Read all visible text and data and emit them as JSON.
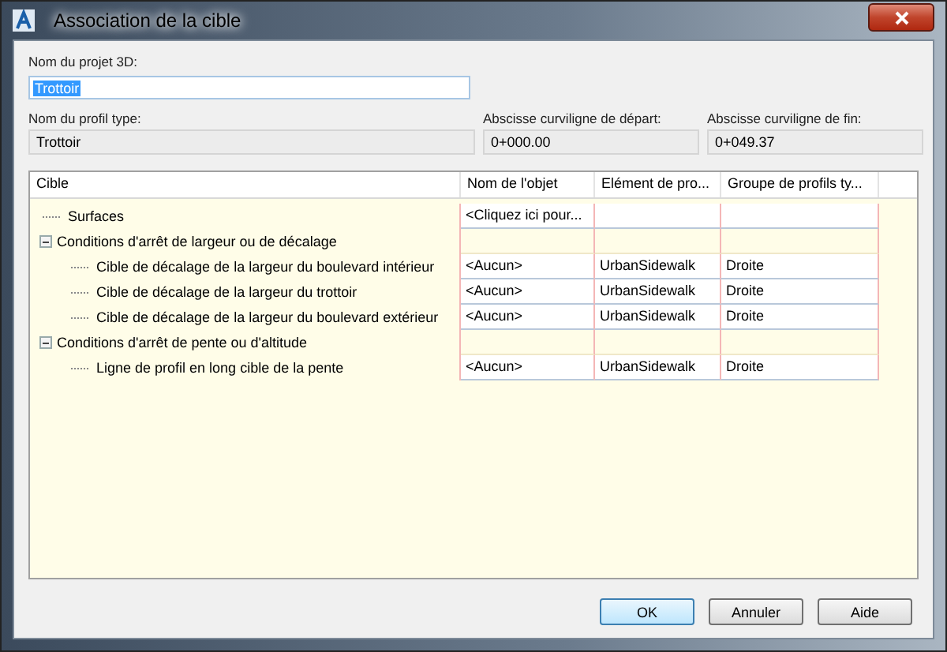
{
  "window": {
    "title": "Association de la cible"
  },
  "project_name": {
    "label": "Nom du projet 3D:",
    "value": "Trottoir"
  },
  "profile_type": {
    "label": "Nom du profil type:",
    "value": "Trottoir"
  },
  "start_station": {
    "label": "Abscisse curviligne de départ:",
    "value": "0+000.00"
  },
  "end_station": {
    "label": "Abscisse curviligne de fin:",
    "value": "0+049.37"
  },
  "table": {
    "columns": [
      "Cible",
      "Nom de l'objet",
      "Elément de pro...",
      "Groupe de profils ty..."
    ],
    "rows": [
      {
        "kind": "item",
        "label": "Surfaces",
        "cells": [
          "<Cliquez ici pour...",
          "",
          ""
        ]
      },
      {
        "kind": "group",
        "label": "Conditions d'arrêt de largeur ou de décalage",
        "expanded": true,
        "children": [
          {
            "kind": "item",
            "label": "Cible de décalage de la largeur du boulevard intérieur",
            "cells": [
              "<Aucun>",
              "UrbanSidewalk",
              "Droite"
            ]
          },
          {
            "kind": "item",
            "label": "Cible de décalage de la largeur du trottoir",
            "cells": [
              "<Aucun>",
              "UrbanSidewalk",
              "Droite"
            ]
          },
          {
            "kind": "item",
            "label": "Cible de décalage de la largeur du boulevard extérieur",
            "cells": [
              "<Aucun>",
              "UrbanSidewalk",
              "Droite"
            ]
          }
        ]
      },
      {
        "kind": "group",
        "label": "Conditions d'arrêt de pente ou d'altitude",
        "expanded": true,
        "children": [
          {
            "kind": "item",
            "label": "Ligne de profil en long cible de la pente",
            "cells": [
              "<Aucun>",
              "UrbanSidewalk",
              "Droite"
            ]
          }
        ]
      }
    ]
  },
  "buttons": [
    "OK",
    "Annuler",
    "Aide"
  ]
}
